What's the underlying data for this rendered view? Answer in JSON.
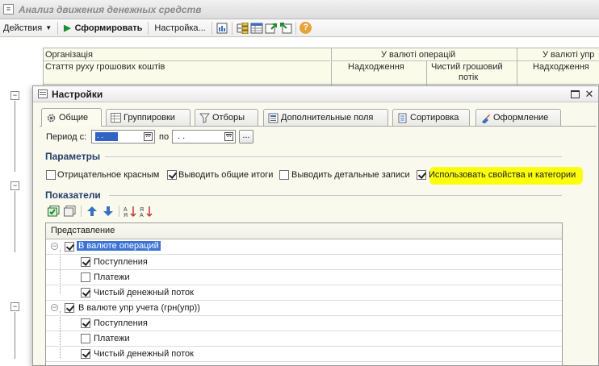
{
  "main_window": {
    "title": "Анализ движения денежных средств"
  },
  "toolbar": {
    "actions_label": "Действия",
    "generate_label": "Сформировать",
    "settings_label": "Настройка...",
    "help_label": "?"
  },
  "report": {
    "header": {
      "col1_row1": "Організація",
      "col1_row2": "Стаття руху грошових коштів",
      "group1": "У валюті операцій",
      "group2": "У валюті упр",
      "sub1": "Надходження",
      "sub2a": "Чистий грошовий",
      "sub2b": "потік",
      "sub3": "Надходження"
    }
  },
  "dialog": {
    "title": "Настройки",
    "tabs": [
      {
        "label": "Общие",
        "icon": "gear-icon"
      },
      {
        "label": "Группировки",
        "icon": "table-icon"
      },
      {
        "label": "Отборы",
        "icon": "filter-icon"
      },
      {
        "label": "Дополнительные поля",
        "icon": "list-icon"
      },
      {
        "label": "Сортировка",
        "icon": "sort-icon"
      },
      {
        "label": "Оформление",
        "icon": "paint-icon"
      }
    ],
    "period": {
      "from_label": "Период с:",
      "from_value": ". .",
      "to_label": "по",
      "to_value": ". .",
      "ellipsis": "..."
    },
    "params_title": "Параметры",
    "params": [
      {
        "label": "Отрицательное красным",
        "checked": false
      },
      {
        "label": "Выводить общие итоги",
        "checked": true
      },
      {
        "label": "Выводить детальные записи",
        "checked": false
      },
      {
        "label": "Использовать свойства и категории",
        "checked": true
      }
    ],
    "indicators_title": "Показатели",
    "grid": {
      "header": "Представление",
      "rows": [
        {
          "label": "В валюте операций",
          "checked": true,
          "level": 0,
          "selected": true
        },
        {
          "label": "Поступления",
          "checked": true,
          "level": 1
        },
        {
          "label": "Платежи",
          "checked": false,
          "level": 1
        },
        {
          "label": "Чистый денежный поток",
          "checked": true,
          "level": 1
        },
        {
          "label": "В валюте упр учета (грн(упр))",
          "checked": true,
          "level": 0,
          "selected": false
        },
        {
          "label": "Поступления",
          "checked": true,
          "level": 1
        },
        {
          "label": "Платежи",
          "checked": false,
          "level": 1
        },
        {
          "label": "Чистый денежный поток",
          "checked": true,
          "level": 1
        }
      ]
    }
  },
  "colors": {
    "accent": "#3d74d4",
    "highlight": "#fbff00",
    "section_title": "#25406d"
  }
}
